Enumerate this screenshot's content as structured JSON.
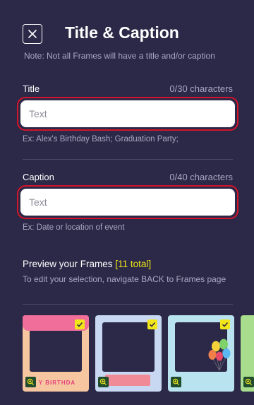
{
  "header": {
    "title": "Title & Caption",
    "note": "Note: Not all Frames will have a title and/or caption"
  },
  "title_field": {
    "label": "Title",
    "count": "0/30 characters",
    "placeholder": "Text",
    "hint": "Ex: Alex's Birthday Bash; Graduation Party;"
  },
  "caption_field": {
    "label": "Caption",
    "count": "0/40 characters",
    "placeholder": "Text",
    "hint": "Ex: Date or location of event"
  },
  "preview": {
    "title": "Preview your Frames",
    "count": "[11 total]",
    "subtitle": "To edit your selection, navigate BACK to Frames page"
  },
  "frames": [
    {
      "theme": "birthday",
      "text": "Y BIRTHDA",
      "selected": true
    },
    {
      "theme": "confetti",
      "selected": true
    },
    {
      "theme": "balloons",
      "selected": true
    },
    {
      "theme": "green",
      "selected": true
    }
  ],
  "colors": {
    "background": "#2b2947",
    "accent_highlight": "#d3142a",
    "count_yellow": "#f2e51a",
    "muted_text": "#a9a8c3"
  },
  "icons": {
    "close": "close-icon",
    "check": "checkmark-icon",
    "zoom": "zoom-in-icon"
  }
}
